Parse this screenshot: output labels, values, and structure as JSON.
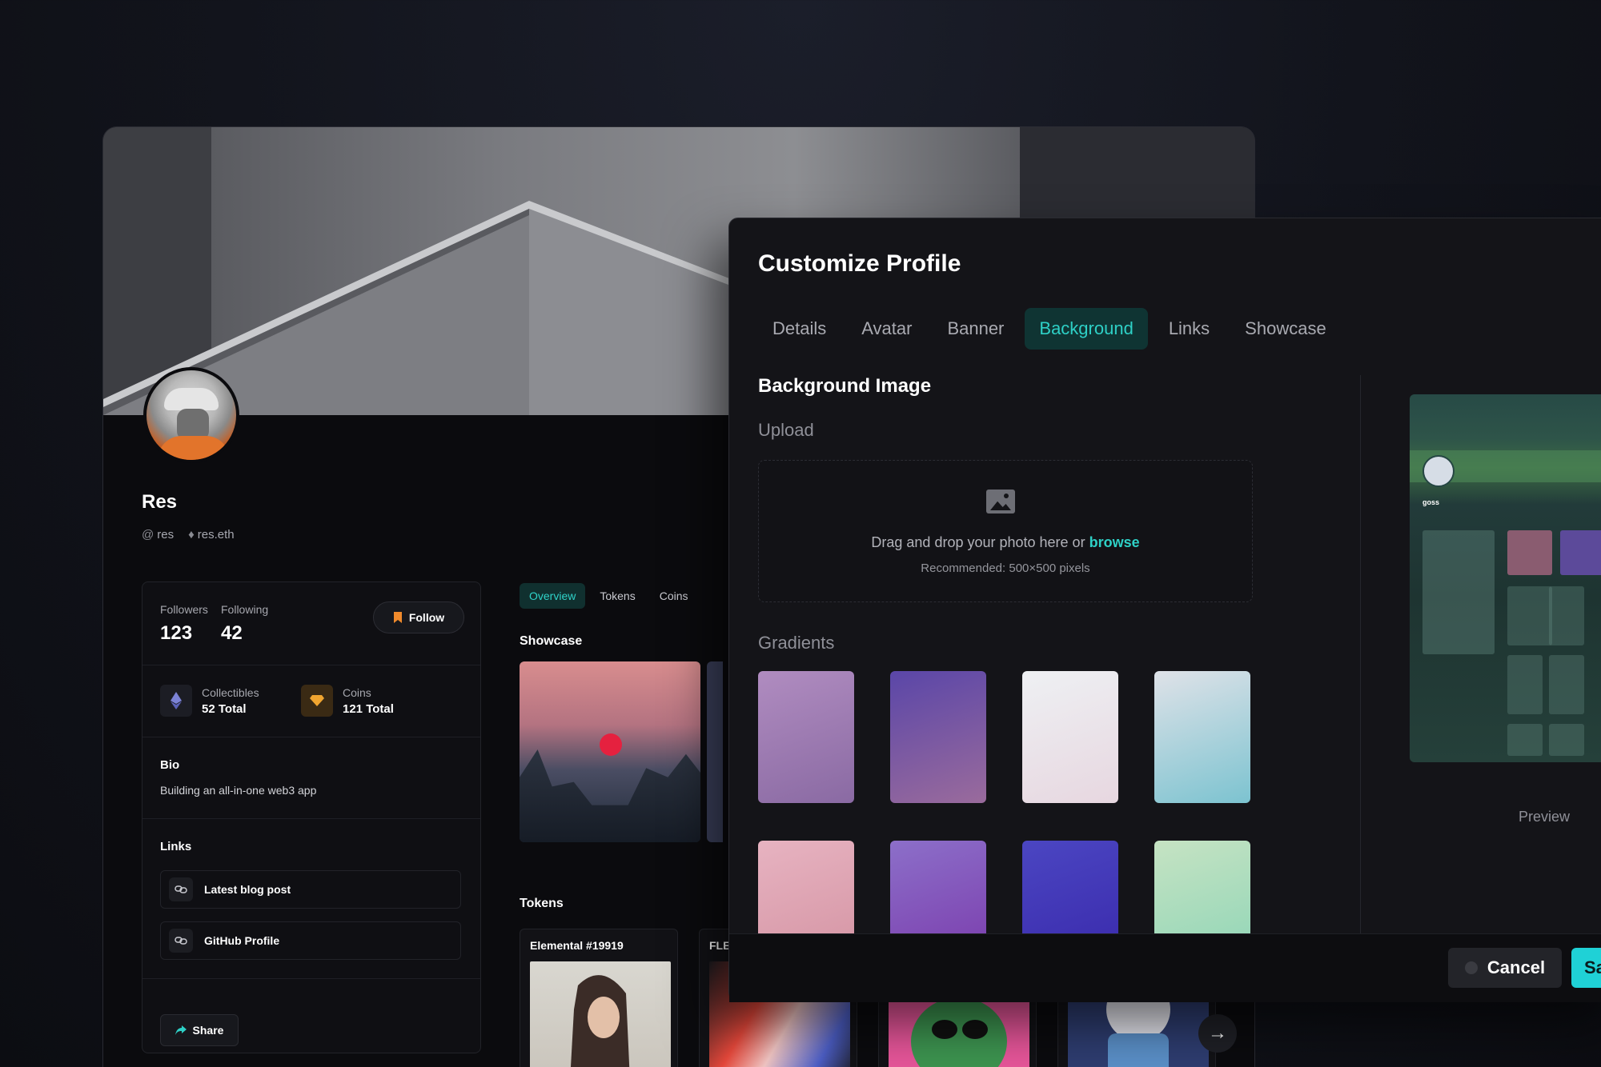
{
  "profile": {
    "name": "Res",
    "handle": "res",
    "ens": "res.eth",
    "followers_label": "Followers",
    "following_label": "Following",
    "followers": "123",
    "following": "42",
    "follow_label": "Follow",
    "collectibles_label": "Collectibles",
    "collectibles_value": "52 Total",
    "coins_label": "Coins",
    "coins_value": "121 Total",
    "bio_title": "Bio",
    "bio_text": "Building an all-in-one web3 app",
    "links_title": "Links",
    "links": [
      {
        "label": "Latest blog post"
      },
      {
        "label": "GitHub Profile"
      }
    ],
    "share_label": "Share"
  },
  "main": {
    "tabs": [
      {
        "label": "Overview",
        "active": true
      },
      {
        "label": "Tokens"
      },
      {
        "label": "Coins"
      }
    ],
    "showcase_title": "Showcase",
    "tokens_title": "Tokens",
    "tokens": [
      {
        "title": "Elemental #19919"
      },
      {
        "title": "FLE"
      }
    ]
  },
  "modal": {
    "title": "Customize Profile",
    "tabs": [
      {
        "label": "Details"
      },
      {
        "label": "Avatar"
      },
      {
        "label": "Banner"
      },
      {
        "label": "Background",
        "active": true
      },
      {
        "label": "Links"
      },
      {
        "label": "Showcase"
      }
    ],
    "section_title": "Background Image",
    "upload_label": "Upload",
    "dropzone_text": "Drag and drop your photo here or",
    "dropzone_link": "browse",
    "dropzone_hint": "Recommended: 500×500 pixels",
    "gradients_label": "Gradients",
    "preview_label": "Preview",
    "preview_name": "goss",
    "cancel_label": "Cancel",
    "save_label": "Save"
  },
  "colors": {
    "accent": "#2ed0c6",
    "save": "#1fd1d6",
    "gradients": [
      [
        "#b08cc0",
        "#8a6aa3"
      ],
      [
        "#5a46a8",
        "#9a6b9c"
      ],
      [
        "#eef0f3",
        "#e7d7e0"
      ],
      [
        "#dfe2e8",
        "#7cc3d0"
      ],
      [
        "#e7b3c1",
        "#d89aa9"
      ],
      [
        "#8c6fc9",
        "#7e46b2"
      ],
      [
        "#4b46c2",
        "#3d2fb0"
      ],
      [
        "#c6e3c3",
        "#9ad8b9"
      ]
    ]
  }
}
